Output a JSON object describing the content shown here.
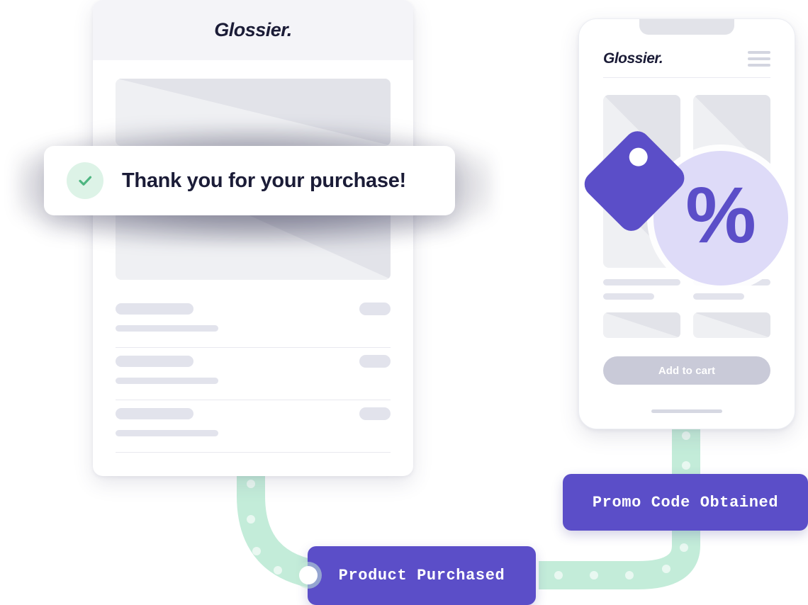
{
  "brand": {
    "name": "Glossier."
  },
  "receipt": {
    "header_logo": "Glossier.",
    "rows": [
      {
        "title_placeholder": "",
        "price_placeholder": "",
        "sub_placeholder": ""
      },
      {
        "title_placeholder": "",
        "price_placeholder": "",
        "sub_placeholder": ""
      },
      {
        "title_placeholder": "",
        "price_placeholder": "",
        "sub_placeholder": ""
      }
    ]
  },
  "toast": {
    "message": "Thank you for your purchase!",
    "icon": "check-icon",
    "icon_bg": "#ddf3e7",
    "icon_color": "#4eb681"
  },
  "phone": {
    "header_logo": "Glossier.",
    "menu_icon": "hamburger-menu-icon",
    "add_to_cart_label": "Add to cart",
    "badge": {
      "percent_glyph": "%",
      "tag_icon": "price-tag-icon",
      "circle_color": "#dedbf8",
      "accent_color": "#5b4ec8"
    }
  },
  "flow": {
    "path_color": "#c3ecd9",
    "dot_color": "#e7f7ef",
    "events": [
      {
        "id": "product-purchased",
        "label": "Product Purchased"
      },
      {
        "id": "promo-code-obtained",
        "label": "Promo Code Obtained"
      }
    ]
  },
  "colors": {
    "accent_purple": "#5b4ec8",
    "mint": "#c3ecd9",
    "green_check": "#4eb681",
    "ink": "#1b1c37",
    "skeleton": "#e2e3ec"
  }
}
